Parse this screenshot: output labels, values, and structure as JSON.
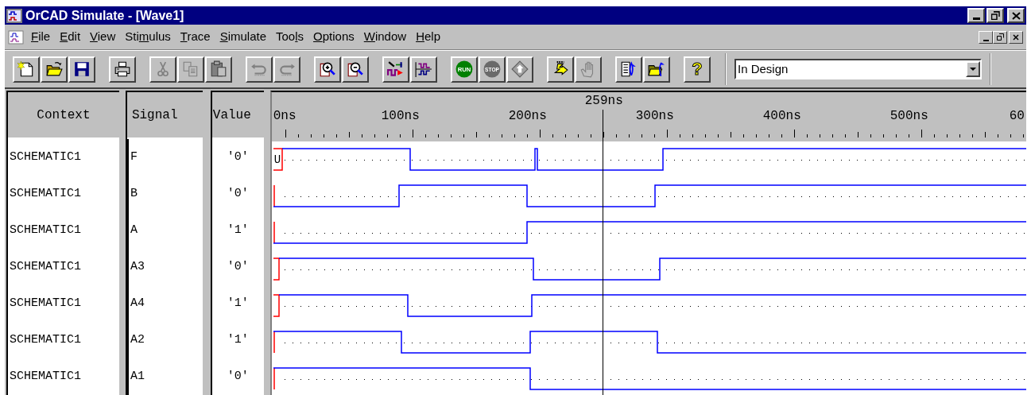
{
  "window": {
    "title": "OrCAD Simulate - [Wave1]"
  },
  "menu": [
    {
      "key": "F",
      "post": "ile"
    },
    {
      "key": "E",
      "post": "dit"
    },
    {
      "key": "V",
      "post": "iew"
    },
    {
      "pre": "Sti",
      "key": "m",
      "post": "ulus"
    },
    {
      "key": "T",
      "post": "race"
    },
    {
      "key": "S",
      "post": "imulate"
    },
    {
      "pre": "Too",
      "key": "l",
      "post": "s"
    },
    {
      "key": "O",
      "post": "ptions"
    },
    {
      "key": "W",
      "post": "indow"
    },
    {
      "key": "H",
      "post": "elp"
    }
  ],
  "toolbar_groups": [
    {
      "buttons": [
        {
          "kind": "new",
          "disabled": false
        },
        {
          "kind": "open",
          "disabled": false
        },
        {
          "kind": "save",
          "disabled": false
        }
      ]
    },
    {
      "buttons": [
        {
          "kind": "print",
          "disabled": false
        }
      ]
    },
    {
      "buttons": [
        {
          "kind": "cut",
          "disabled": true
        },
        {
          "kind": "copy",
          "disabled": true
        },
        {
          "kind": "paste",
          "disabled": true
        }
      ]
    },
    {
      "buttons": [
        {
          "kind": "undo",
          "disabled": true
        },
        {
          "kind": "redo",
          "disabled": true
        }
      ]
    },
    {
      "buttons": [
        {
          "kind": "zoom_in",
          "disabled": false
        },
        {
          "kind": "zoom_out",
          "disabled": false
        }
      ]
    },
    {
      "buttons": [
        {
          "kind": "stimulus",
          "disabled": false
        },
        {
          "kind": "wave",
          "disabled": false
        }
      ]
    },
    {
      "buttons": [
        {
          "kind": "run",
          "label": "RUN",
          "disabled": false
        },
        {
          "kind": "stop",
          "label": "STOP",
          "disabled": true
        },
        {
          "kind": "step",
          "disabled": true
        }
      ]
    },
    {
      "buttons": [
        {
          "kind": "arrow",
          "disabled": false
        },
        {
          "kind": "hand",
          "disabled": true
        }
      ]
    },
    {
      "buttons": [
        {
          "kind": "doc",
          "disabled": false
        },
        {
          "kind": "folder",
          "disabled": false
        }
      ]
    },
    {
      "buttons": [
        {
          "kind": "help",
          "label": "?",
          "disabled": false
        }
      ]
    }
  ],
  "design_dropdown": {
    "value": "In Design"
  },
  "columns": [
    "Context",
    "Signal",
    "Value"
  ],
  "timeline": {
    "cursor": "259ns",
    "ticks": [
      "0ns",
      "100ns",
      "200ns",
      "300ns",
      "400ns",
      "500ns",
      "60"
    ]
  },
  "rows": [
    {
      "context": "SCHEMATIC1",
      "signal": "F",
      "value": "'0'",
      "initial": "U"
    },
    {
      "context": "SCHEMATIC1",
      "signal": "B",
      "value": "'0'"
    },
    {
      "context": "SCHEMATIC1",
      "signal": "A",
      "value": "'1'"
    },
    {
      "context": "SCHEMATIC1",
      "signal": "A3",
      "value": "'0'"
    },
    {
      "context": "SCHEMATIC1",
      "signal": "A4",
      "value": "'1'"
    },
    {
      "context": "SCHEMATIC1",
      "signal": "A2",
      "value": "'1'"
    },
    {
      "context": "SCHEMATIC1",
      "signal": "A1",
      "value": "'0'"
    }
  ]
}
